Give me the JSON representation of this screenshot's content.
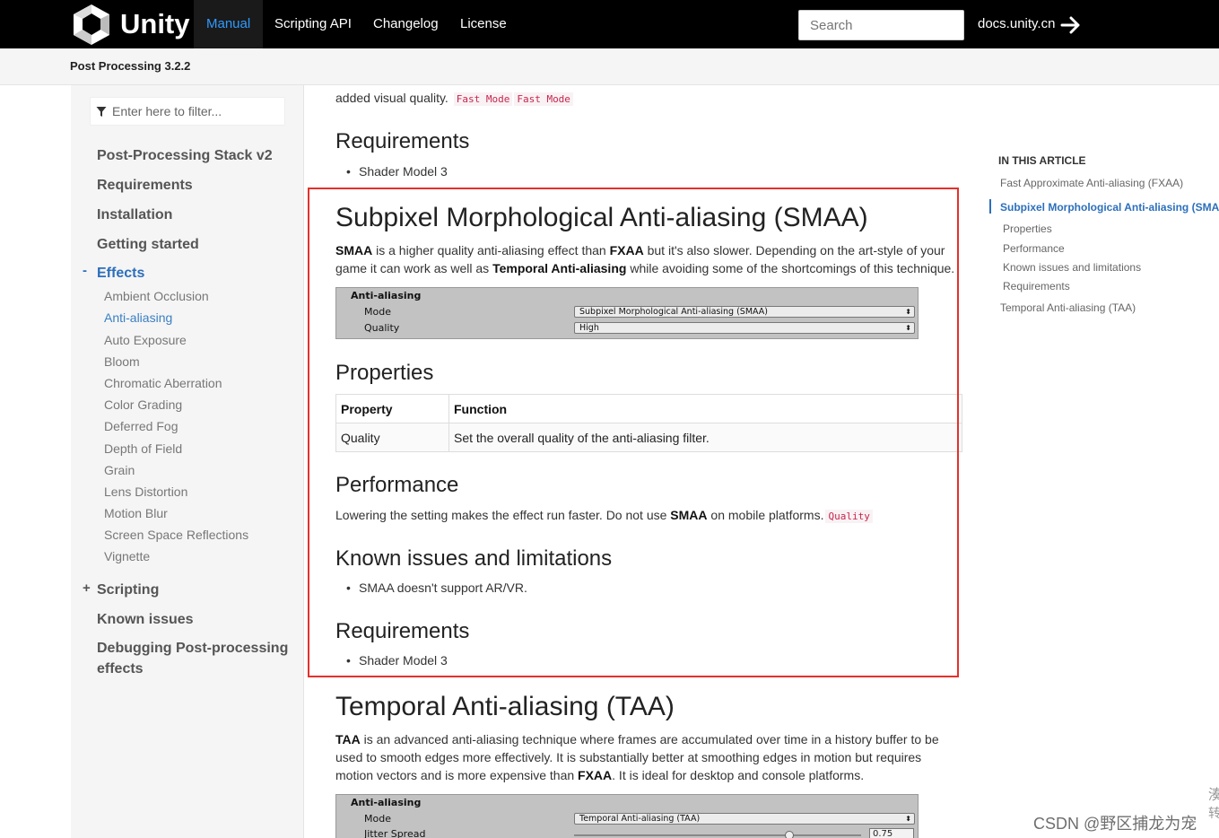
{
  "nav": {
    "brand": "Unity",
    "items": [
      "Manual",
      "Scripting API",
      "Changelog",
      "License"
    ],
    "active": "Manual",
    "search_placeholder": "Search",
    "docs_link": "docs.unity.cn"
  },
  "subheader": {
    "title": "Post Processing 3.2.2"
  },
  "sidebar": {
    "filter_placeholder": "Enter here to filter...",
    "toggle_effects": "-",
    "toggle_scripting": "+",
    "top_items": [
      "Post-Processing Stack v2",
      "Requirements",
      "Installation",
      "Getting started",
      "Effects",
      "Scripting",
      "Known issues",
      "Debugging Post-processing",
      "effects"
    ],
    "effects": [
      "Ambient Occlusion",
      "Anti-aliasing",
      "Auto Exposure",
      "Bloom",
      "Chromatic Aberration",
      "Color Grading",
      "Deferred Fog",
      "Depth of Field",
      "Grain",
      "Lens Distortion",
      "Motion Blur",
      "Screen Space Reflections",
      "Vignette"
    ],
    "active_effect": "Anti-aliasing"
  },
  "content": {
    "top_fragment": "added visual quality.",
    "code_fast_1": "Fast Mode",
    "code_fast_2": "Fast Mode",
    "req1_title": "Requirements",
    "req1_item": "Shader Model 3",
    "smaa_title": "Subpixel Morphological Anti-aliasing (SMAA)",
    "smaa_p": {
      "b1": "SMAA",
      "t1": " is a higher quality anti-aliasing effect than ",
      "b2": "FXAA",
      "t2": " but it's also slower. Depending on the art-style of your game it can work as well as ",
      "b3": "Temporal Anti-aliasing",
      "t3": " while avoiding some of the shortcomings of this technique."
    },
    "inspector1": {
      "title": "Anti-aliasing",
      "rows": [
        {
          "label": "Mode",
          "value": "Subpixel Morphological Anti-aliasing (SMAA)"
        },
        {
          "label": "Quality",
          "value": "High"
        }
      ]
    },
    "props_title": "Properties",
    "table": {
      "headers": [
        "Property",
        "Function"
      ],
      "rows": [
        [
          "Quality",
          "Set the overall quality of the anti-aliasing filter."
        ]
      ]
    },
    "perf_title": "Performance",
    "perf_p": {
      "t1": "Lowering the setting makes the effect run faster. Do not use ",
      "b1": "SMAA",
      "t2": " on mobile platforms.",
      "code": "Quality"
    },
    "known_title": "Known issues and limitations",
    "known_item": "SMAA doesn't support AR/VR.",
    "req2_title": "Requirements",
    "req2_item": "Shader Model 3",
    "taa_title": "Temporal Anti-aliasing (TAA)",
    "taa_p": {
      "b1": "TAA",
      "t1": " is an advanced anti-aliasing technique where frames are accumulated over time in a history buffer to be used to smooth edges more effectively. It is substantially better at smoothing edges in motion but requires motion vectors and is more expensive than ",
      "b2": "FXAA",
      "t2": ". It is ideal for desktop and console platforms."
    },
    "inspector2": {
      "title": "Anti-aliasing",
      "mode_label": "Mode",
      "mode_value": "Temporal Anti-aliasing (TAA)",
      "jitter_label": "Jitter Spread",
      "jitter_value": "0.75",
      "jitter_level": 0.75
    }
  },
  "toc": {
    "heading": "IN THIS ARTICLE",
    "items": [
      "Fast Approximate Anti-aliasing (FXAA)",
      "Subpixel Morphological Anti-aliasing (SMAA",
      "Properties",
      "Performance",
      "Known issues and limitations",
      "Requirements",
      "Temporal Anti-aliasing (TAA)"
    ]
  },
  "watermark": "CSDN @野区捕龙为宠",
  "edge_chars": [
    "湊",
    "转"
  ],
  "colors": {
    "accent": "#2c6fbb",
    "highlight": "#e5302b",
    "code": "#c7254e"
  }
}
